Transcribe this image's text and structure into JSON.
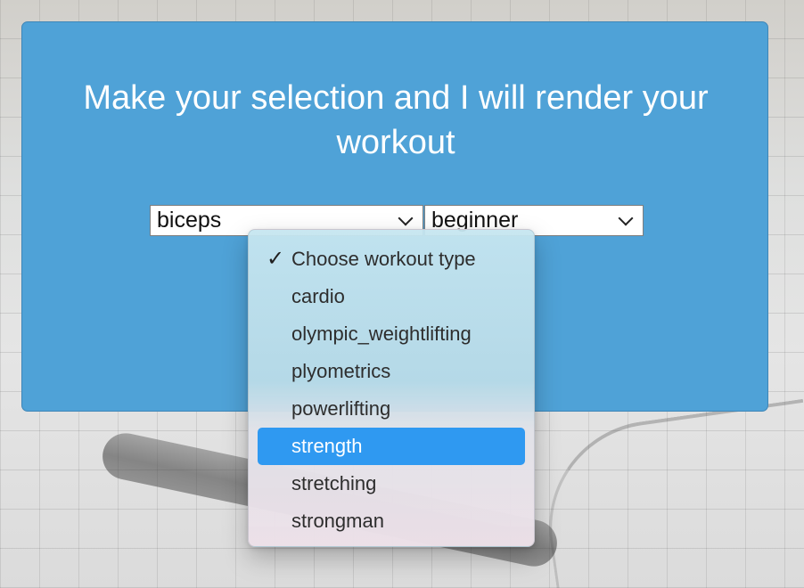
{
  "page": {
    "title_line1": "Make your selection and I will render your",
    "title_line2": "workout"
  },
  "controls": {
    "muscle_select": {
      "value": "biceps"
    },
    "difficulty_select": {
      "value": "beginner"
    },
    "workout_type_dropdown": {
      "checked_option": "Choose workout type",
      "highlighted_option": "strength",
      "options": [
        "Choose workout type",
        "cardio",
        "olympic_weightlifting",
        "plyometrics",
        "powerlifting",
        "strength",
        "stretching",
        "strongman"
      ]
    }
  },
  "icons": {
    "check": "check-icon",
    "chevron": "chevron-down-icon"
  },
  "colors": {
    "panel": "#4fa2d7",
    "dropdown_highlight": "#2f99f1",
    "white": "#ffffff"
  }
}
